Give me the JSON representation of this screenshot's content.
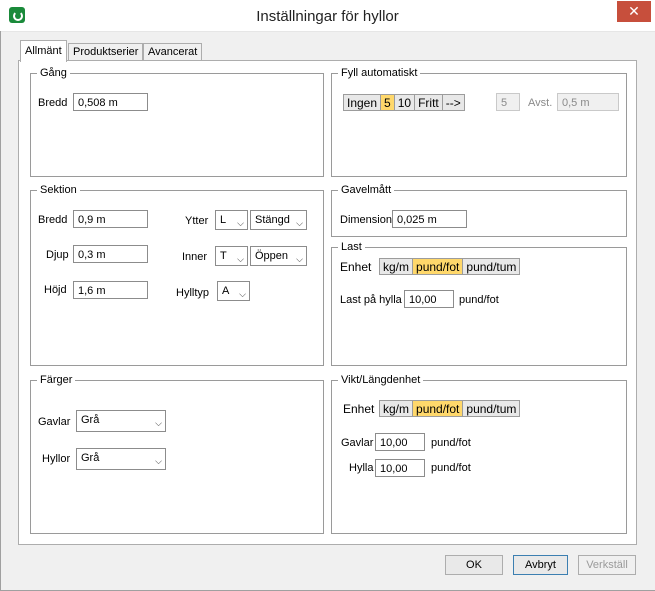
{
  "window": {
    "title": "Inställningar för hyllor",
    "close": "✕"
  },
  "tabs": [
    "Allmänt",
    "Produktserier",
    "Avancerat"
  ],
  "gang": {
    "title": "Gång",
    "bredd_label": "Bredd",
    "bredd_value": "0,508 m"
  },
  "fyll": {
    "title": "Fyll automatiskt",
    "options": [
      "Ingen",
      "5",
      "10",
      "Fritt",
      "-->"
    ],
    "count_value": "5",
    "avst_label": "Avst.",
    "avst_value": "0,5 m"
  },
  "sektion": {
    "title": "Sektion",
    "bredd_label": "Bredd",
    "bredd_value": "0,9 m",
    "djup_label": "Djup",
    "djup_value": "0,3 m",
    "hojd_label": "Höjd",
    "hojd_value": "1,6 m",
    "ytter_label": "Ytter",
    "ytter_a": "L",
    "ytter_b": "Stängd",
    "inner_label": "Inner",
    "inner_a": "T",
    "inner_b": "Öppen",
    "hylltyp_label": "Hylltyp",
    "hylltyp_value": "A"
  },
  "gavel": {
    "title": "Gavelmått",
    "dim_label": "Dimension",
    "dim_value": "0,025 m"
  },
  "last": {
    "title": "Last",
    "enhet_label": "Enhet",
    "units": [
      "kg/m",
      "pund/fot",
      "pund/tum"
    ],
    "last_label": "Last på hylla",
    "last_value": "10,00",
    "last_unit": "pund/fot"
  },
  "farger": {
    "title": "Färger",
    "gavlar_label": "Gavlar",
    "gavlar_value": "Grå",
    "hyllor_label": "Hyllor",
    "hyllor_value": "Grå"
  },
  "vikt": {
    "title": "Vikt/Längdenhet",
    "enhet_label": "Enhet",
    "units": [
      "kg/m",
      "pund/fot",
      "pund/tum"
    ],
    "gavlar_label": "Gavlar",
    "gavlar_value": "10,00",
    "gavlar_unit": "pund/fot",
    "hylla_label": "Hylla",
    "hylla_value": "10,00",
    "hylla_unit": "pund/fot"
  },
  "buttons": {
    "ok": "OK",
    "avbryt": "Avbryt",
    "verkstall": "Verkställ"
  },
  "colors": {
    "selected_unit": "#ffd86b",
    "close_button": "#c74f3c"
  }
}
